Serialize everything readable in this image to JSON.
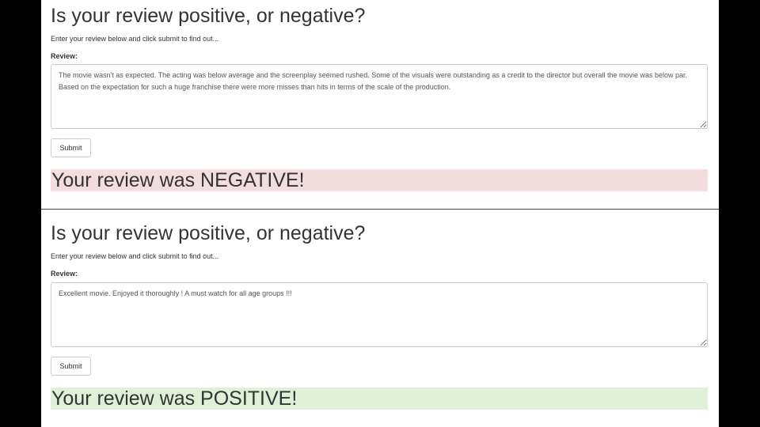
{
  "panels": [
    {
      "heading": "Is your review positive, or negative?",
      "instructions": "Enter your review below and click submit to find out...",
      "review_label": "Review:",
      "review_text": "The movie wasn't as expected. The acting was below average and the screenplay seemed rushed. Some of the visuals were outstanding as a credit to the director but overall the movie was below par. Based on the expectation for such a huge franchise there were more misses than hits in terms of the scale of the production.",
      "submit_label": "Submit",
      "result_text": "Your review was NEGATIVE!",
      "result_color": "#f2dede"
    },
    {
      "heading": "Is your review positive, or negative?",
      "instructions": "Enter your review below and click submit to find out...",
      "review_label": "Review:",
      "review_text": "Excellent movie. Enjoyed it thoroughly ! A must watch for all age groups !!!",
      "submit_label": "Submit",
      "result_text": "Your review was POSITIVE!",
      "result_color": "#dff0d8"
    }
  ]
}
